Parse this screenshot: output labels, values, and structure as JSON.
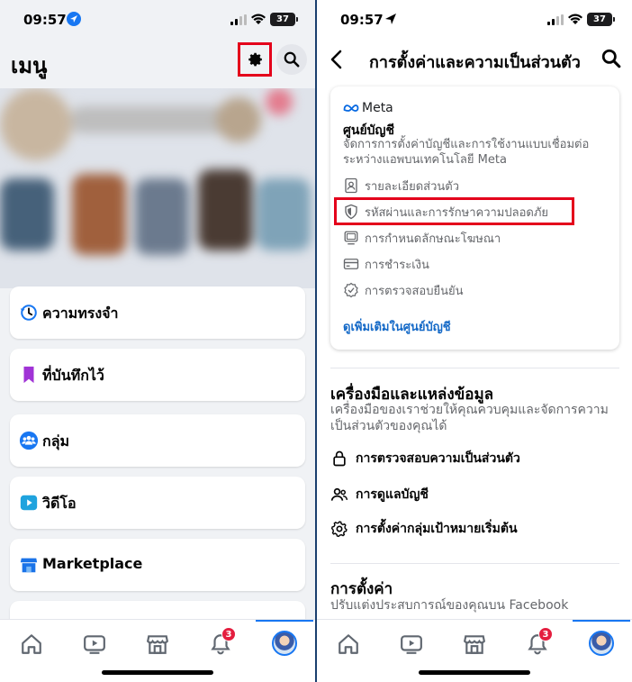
{
  "left": {
    "status": {
      "time": "09:57",
      "battery": "37"
    },
    "header": {
      "title": "เมนู",
      "settings_icon": "gear-icon",
      "search_icon": "search-icon"
    },
    "items": [
      {
        "label": "ความทรงจำ",
        "icon": "clock-history-icon",
        "color": "#1877f2"
      },
      {
        "label": "ที่บันทึกไว้",
        "icon": "bookmark-icon",
        "color": "#a033d6"
      },
      {
        "label": "กลุ่ม",
        "icon": "groups-icon",
        "color": "#1877f2"
      },
      {
        "label": "วิดีโอ",
        "icon": "video-icon",
        "color": "#1fa3de"
      },
      {
        "label": "Marketplace",
        "icon": "marketplace-icon",
        "color": "#1a73e8"
      }
    ],
    "tabbar": {
      "notification_count": "3"
    }
  },
  "right": {
    "status": {
      "time": "09:57",
      "battery": "37"
    },
    "header": {
      "title": "การตั้งค่าและความเป็นส่วนตัว"
    },
    "meta_card": {
      "logo_text": "Meta",
      "title": "ศูนย์บัญชี",
      "description": "จัดการการตั้งค่าบัญชีและการใช้งานแบบเชื่อมต่อระหว่างแอพบนเทคโนโลยี Meta",
      "items": [
        {
          "label": "รายละเอียดส่วนตัว",
          "icon": "id-card-icon"
        },
        {
          "label": "รหัสผ่านและการรักษาความปลอดภัย",
          "icon": "shield-icon"
        },
        {
          "label": "การกำหนดลักษณะโฆษณา",
          "icon": "monitor-icon"
        },
        {
          "label": "การชำระเงิน",
          "icon": "credit-card-icon"
        },
        {
          "label": "การตรวจสอบยืนยัน",
          "icon": "verified-badge-icon"
        }
      ],
      "link": "ดูเพิ่มเติมในศูนย์บัญชี"
    },
    "tools": {
      "title": "เครื่องมือและแหล่งข้อมูล",
      "description": "เครื่องมือของเราช่วยให้คุณควบคุมและจัดการความเป็นส่วนตัวของคุณได้",
      "items": [
        {
          "label": "การตรวจสอบความเป็นส่วนตัว",
          "icon": "lock-icon"
        },
        {
          "label": "การดูแลบัญชี",
          "icon": "people-icon"
        },
        {
          "label": "การตั้งค่ากลุ่มเป้าหมายเริ่มต้น",
          "icon": "gear-icon"
        }
      ]
    },
    "settings": {
      "title": "การตั้งค่า",
      "description": "ปรับแต่งประสบการณ์ของคุณบน Facebook"
    },
    "tabbar": {
      "notification_count": "3"
    }
  }
}
